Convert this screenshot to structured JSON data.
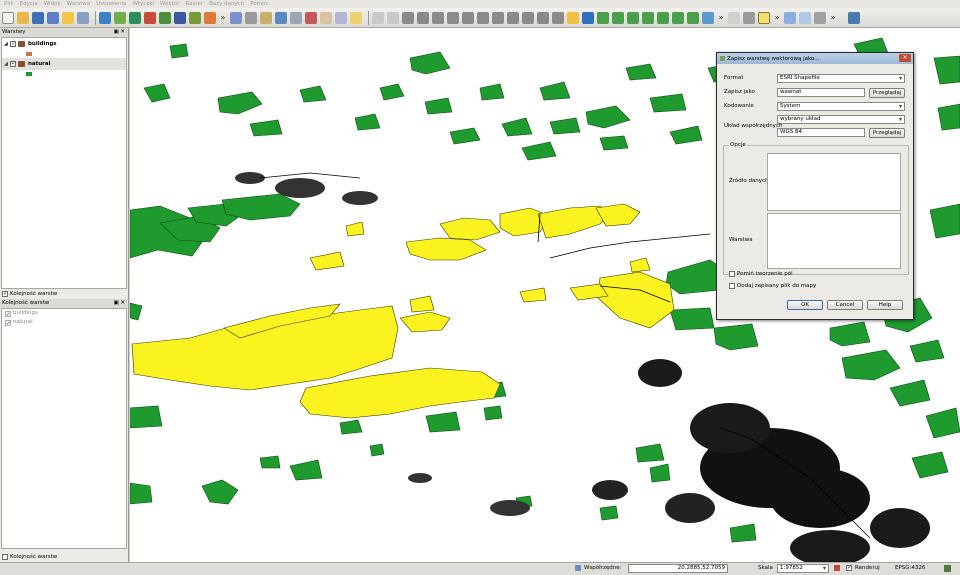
{
  "menu": [
    "Plik",
    "Edycja",
    "Widok",
    "Warstwa",
    "Ustawienia",
    "Wtyczki",
    "Wektor",
    "Raster",
    "Bazy danych",
    "Pomoc"
  ],
  "toolbar_more": "»",
  "layers_panel": {
    "title": "Warstwy",
    "layers": [
      {
        "name": "buildings",
        "checked": true,
        "symbol_color": "#c87a46"
      },
      {
        "name": "natural",
        "checked": true,
        "symbol_color": "#1b9a2f"
      }
    ],
    "order_checkbox_label": "Kolejność warstw"
  },
  "order_panel": {
    "title": "Kolejność warstw",
    "layers": [
      "buildings",
      "natural"
    ],
    "bottom_checkbox_label": "Kolejność warstw"
  },
  "map": {
    "colors": {
      "forest": "#1f9a2f",
      "yellow": "#fbf31f",
      "buildings": "#000000",
      "background": "#ffffff"
    }
  },
  "dialog": {
    "title": "Zapisz warstwę wektorową jako...",
    "format_label": "Format",
    "format_value": "ESRI Shapefile",
    "save_as_label": "Zapisz jako",
    "save_as_value": "wawnat",
    "browse_label": "Przeglądaj",
    "encoding_label": "Kodowanie",
    "encoding_value": "System",
    "crs_label": "Układ współrzędnych",
    "crs_select": "wybrany układ",
    "crs_value": "WGS 84",
    "browse2_label": "Przeglądaj",
    "options_label": "Opcje",
    "datasource_label": "Źródło danych",
    "layer_label": "Warstwa",
    "skip_output_label": "Pomiń tworzenie pól",
    "add_to_map_label": "Dodaj zapisany plik do mapy",
    "ok_label": "OK",
    "cancel_label": "Cancel",
    "help_label": "Help"
  },
  "status": {
    "coords_label": "Współrzędne:",
    "coords_value": "20.2885,52.7059",
    "scale_label": "Skala",
    "scale_value": "1:97852",
    "render_label": "Renderuj",
    "crs": "EPSG:4326"
  }
}
